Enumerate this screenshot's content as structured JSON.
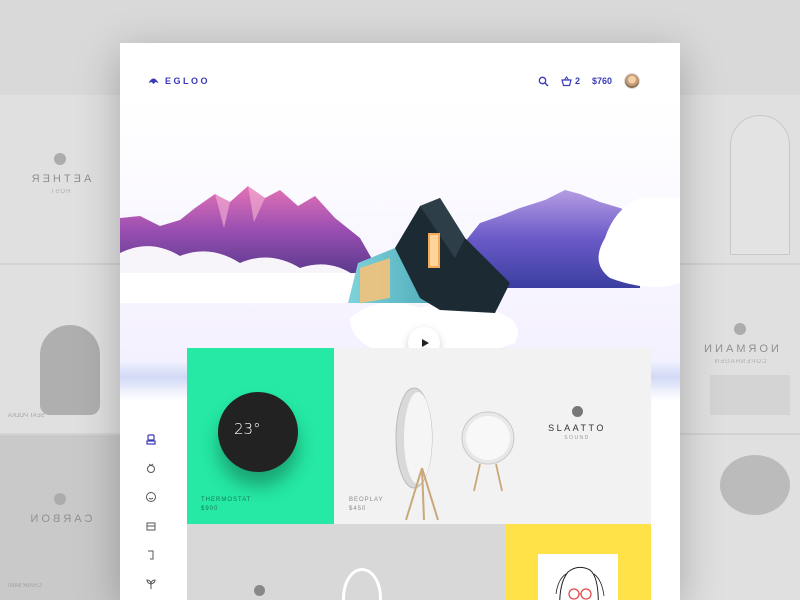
{
  "app": {
    "logo_text": "EGLOO",
    "cart_count": "2",
    "cart_total": "$760"
  },
  "colors": {
    "brand": "#3a3ab8",
    "thermostat_bg": "#25e9a4",
    "yellow_card": "#ffe148"
  },
  "icons": {
    "logo": "umbrella-icon",
    "search": "search-icon",
    "cart": "basket-icon",
    "play": "play-icon",
    "rail": [
      "robot-icon",
      "ring-icon",
      "smiley-icon",
      "cube-icon",
      "phone-icon",
      "plant-icon"
    ]
  },
  "background": {
    "left_tiles": [
      {
        "brand": "AETHER",
        "sub": "HOST"
      },
      {
        "caption": "SEAT POLKA"
      },
      {
        "brand": "CARBON",
        "caption": "CHAIR $480"
      }
    ],
    "right_tiles": [
      {
        "brand": "NORMANN",
        "sub": "COPENHAGEN"
      }
    ]
  },
  "products": {
    "thermostat": {
      "temperature": "23°",
      "name": "THERMOSTAT",
      "price": "$900"
    },
    "beoplay": {
      "name": "BEOPLAY",
      "price": "$450",
      "brand": "SLAATTO",
      "brand_sub": "SOUND"
    }
  }
}
